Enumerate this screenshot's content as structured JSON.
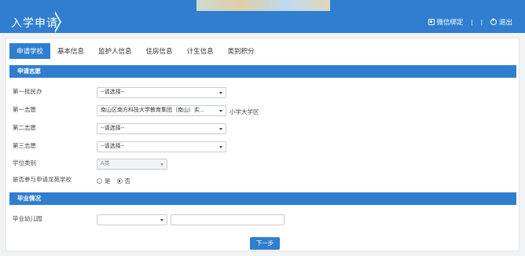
{
  "header": {
    "title": "入学申请",
    "wechat_label": "微信绑定",
    "separator": "|",
    "logout_label": "退出"
  },
  "tabs": [
    {
      "label": "申请学校",
      "active": true
    },
    {
      "label": "基本信息",
      "active": false
    },
    {
      "label": "监护人信息",
      "active": false
    },
    {
      "label": "住房信息",
      "active": false
    },
    {
      "label": "计生信息",
      "active": false
    },
    {
      "label": "类别积分",
      "active": false
    }
  ],
  "sections": {
    "choices_title": "申请志愿",
    "graduation_title": "毕业情况"
  },
  "form": {
    "first_batch": {
      "label": "第一批民办",
      "value": "--请选择--"
    },
    "choice1": {
      "label": "第一志愿",
      "value": "南山区南方科技大学教育集团（南山）实...",
      "suffix": "小学大学区"
    },
    "choice2": {
      "label": "第二志愿",
      "value": "--请选择--"
    },
    "choice3": {
      "label": "第三志愿",
      "value": "--请选择--"
    },
    "degree_type": {
      "label": "学位类别",
      "value": "A类"
    },
    "lottery": {
      "label": "是否参与申请龙苑学校",
      "options": [
        "是",
        "否"
      ],
      "selected": "否"
    },
    "kindergarten": {
      "label": "毕业幼儿园",
      "select_value": "",
      "text_value": ""
    }
  },
  "actions": {
    "next_label": "下一步"
  },
  "colors": {
    "primary": "#2f7ed0",
    "background": "#f2f3f5"
  }
}
